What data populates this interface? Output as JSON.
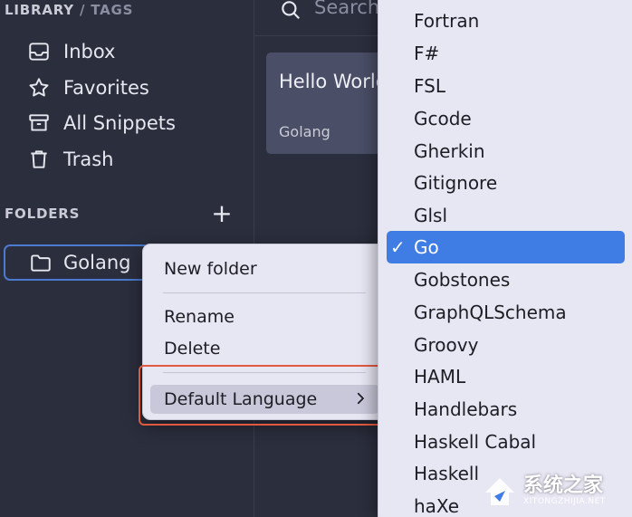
{
  "sidebar": {
    "header": {
      "library": "LIBRARY",
      "separator": "/",
      "tags": "TAGS"
    },
    "library_items": [
      {
        "label": "Inbox",
        "icon": "inbox-icon"
      },
      {
        "label": "Favorites",
        "icon": "star-icon"
      },
      {
        "label": "All Snippets",
        "icon": "archive-icon"
      },
      {
        "label": "Trash",
        "icon": "trash-icon"
      }
    ],
    "folders_header": "FOLDERS",
    "add_folder_label": "+",
    "folders": [
      {
        "label": "Golang",
        "icon": "folder-icon"
      }
    ]
  },
  "search": {
    "placeholder": "Search"
  },
  "snippet": {
    "title": "Hello World",
    "language": "Golang"
  },
  "context_menu": {
    "new_folder": "New folder",
    "rename": "Rename",
    "delete": "Delete",
    "default_language": "Default Language"
  },
  "language_menu": {
    "items": [
      "Fortran",
      "F#",
      "FSL",
      "Gcode",
      "Gherkin",
      "Gitignore",
      "Glsl",
      "Go",
      "Gobstones",
      "GraphQLSchema",
      "Groovy",
      "HAML",
      "Handlebars",
      "Haskell Cabal",
      "Haskell",
      "haXe"
    ],
    "selected": "Go",
    "check": "✓"
  },
  "watermark": {
    "name": "系统之家",
    "site": "XITONGZHIJIA.NET"
  },
  "colors": {
    "sidebar_bg": "#2b2e3d",
    "menu_bg": "#e7e6f3",
    "selection": "#3f7de4",
    "highlight_border": "#e05a3f",
    "folder_border": "#4a7bd0"
  }
}
